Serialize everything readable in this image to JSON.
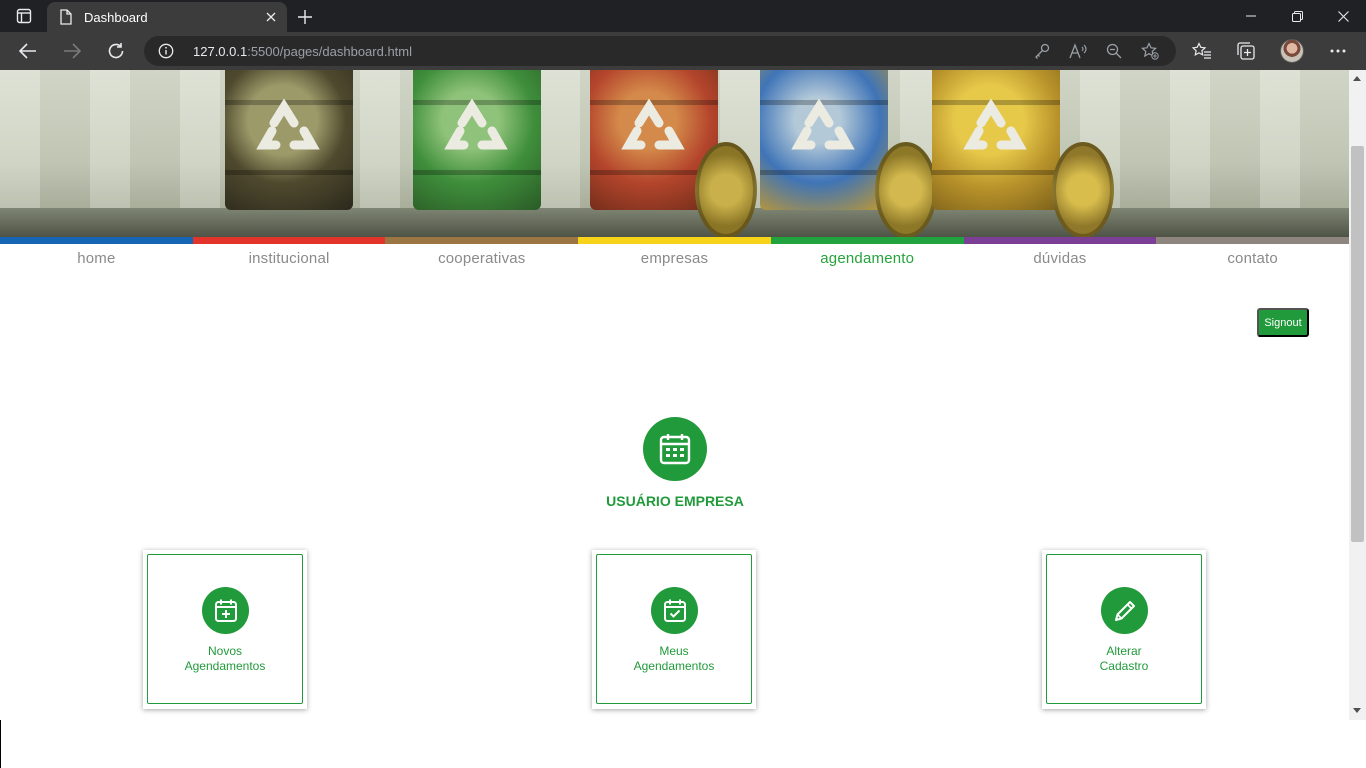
{
  "browser": {
    "tab_title": "Dashboard",
    "url_host": "127.0.0.1",
    "url_rest": ":5500/pages/dashboard.html",
    "icons": [
      "sidebar-icon",
      "document-icon",
      "close-icon",
      "plus-icon",
      "minimize-icon",
      "restore-icon",
      "close-window-icon",
      "back-icon",
      "forward-icon",
      "reload-icon",
      "info-icon",
      "key-icon",
      "read-aloud-icon",
      "zoom-out-icon",
      "add-favorite-icon",
      "favorites-icon",
      "collections-icon",
      "profile-avatar",
      "more-icon"
    ]
  },
  "nav": {
    "strip_colors": [
      "#1565b4",
      "#e3342b",
      "#9c7545",
      "#f7d31a",
      "#21a440",
      "#7b3f96",
      "#8e857e"
    ],
    "items": [
      {
        "label": "home"
      },
      {
        "label": "institucional"
      },
      {
        "label": "cooperativas"
      },
      {
        "label": "empresas"
      },
      {
        "label": "agendamento"
      },
      {
        "label": "dúvidas"
      },
      {
        "label": "contato"
      }
    ],
    "active_index": 4
  },
  "signout_label": "Signout",
  "hero": {
    "title": "USUÁRIO EMPRESA",
    "icon": "calendar-icon"
  },
  "cards": [
    {
      "line1": "Novos",
      "line2": "Agendamentos",
      "icon": "calendar-plus-icon"
    },
    {
      "line1": "Meus",
      "line2": "Agendamentos",
      "icon": "calendar-check-icon"
    },
    {
      "line1": "Alterar",
      "line2": "Cadastro",
      "icon": "pencil-icon"
    }
  ],
  "colors": {
    "brand_green": "#219a3b",
    "browser_dark": "#202124"
  }
}
